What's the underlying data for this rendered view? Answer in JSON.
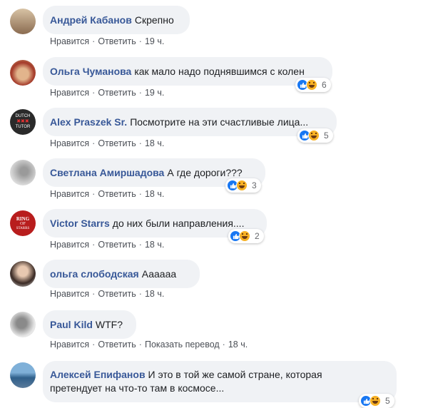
{
  "action_labels": {
    "like": "Нравится",
    "reply": "Ответить",
    "translate": "Показать перевод",
    "sep": "·"
  },
  "colors": {
    "author": "#385898",
    "bubble": "#f0f2f5",
    "like": "#1877f2",
    "haha": "#f7b125"
  },
  "comments": [
    {
      "author": "Андрей Кабанов",
      "text": "Скрепно",
      "time": "19 ч."
    },
    {
      "author": "Ольга Чуманова",
      "text": "как мало надо поднявшимся с колен",
      "time": "19 ч.",
      "reaction_count": "6",
      "reactions": [
        "like-icon",
        "haha-icon"
      ]
    },
    {
      "author": "Alex Praszek Sr.",
      "text": "Посмотрите на эти счастливые лица...",
      "time": "18 ч.",
      "reaction_count": "5",
      "reactions": [
        "like-icon",
        "haha-icon"
      ],
      "avatar_text": [
        "DUTCH",
        "TUTOR"
      ]
    },
    {
      "author": "Светлана Амиршадова",
      "text": "А где дороги???",
      "time": "18 ч.",
      "reaction_count": "3",
      "reactions": [
        "like-icon",
        "haha-icon"
      ]
    },
    {
      "author": "Victor Starrs",
      "text": "до них были направления....",
      "time": "18 ч.",
      "reaction_count": "2",
      "reactions": [
        "like-icon",
        "haha-icon"
      ],
      "avatar_text": [
        "RING",
        "OF",
        "STARRS"
      ]
    },
    {
      "author": "ольга слободская",
      "text": "Аааааа",
      "time": "18 ч."
    },
    {
      "author": "Paul Kild",
      "text": "WTF?",
      "time": "18 ч.",
      "translate": true
    },
    {
      "author": "Алексей Епифанов",
      "text": "И это в той же самой стране, которая",
      "text2": "претендует на что-то там в космосе...",
      "reaction_count": "5",
      "reactions": [
        "like-icon",
        "haha-icon"
      ]
    }
  ]
}
